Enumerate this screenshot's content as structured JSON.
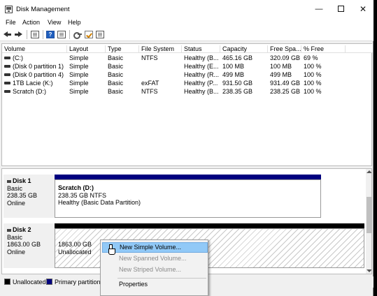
{
  "window": {
    "title": "Disk Management",
    "minimize_glyph": "—",
    "close_glyph": "✕"
  },
  "menu": [
    "File",
    "Action",
    "View",
    "Help"
  ],
  "toolbar": {
    "icons": [
      "back-arrow-icon",
      "forward-arrow-icon",
      "console-tree-icon",
      "help-icon",
      "properties-icon",
      "rescan-key-icon",
      "check-disks-icon",
      "settings-list-icon"
    ]
  },
  "volume_list": {
    "columns": [
      "Volume",
      "Layout",
      "Type",
      "File System",
      "Status",
      "Capacity",
      "Free Spa...",
      "% Free"
    ],
    "rows": [
      [
        "(C:)",
        "Simple",
        "Basic",
        "NTFS",
        "Healthy (B...",
        "465.16 GB",
        "320.09 GB",
        "69 %"
      ],
      [
        "(Disk 0 partition 1)",
        "Simple",
        "Basic",
        "",
        "Healthy (E...",
        "100 MB",
        "100 MB",
        "100 %"
      ],
      [
        "(Disk 0 partition 4)",
        "Simple",
        "Basic",
        "",
        "Healthy (R...",
        "499 MB",
        "499 MB",
        "100 %"
      ],
      [
        "1TB Lacie (K:)",
        "Simple",
        "Basic",
        "exFAT",
        "Healthy (P...",
        "931.50 GB",
        "931.49 GB",
        "100 %"
      ],
      [
        "Scratch (D:)",
        "Simple",
        "Basic",
        "NTFS",
        "Healthy (B...",
        "238.35 GB",
        "238.25 GB",
        "100 %"
      ]
    ]
  },
  "disks": [
    {
      "name": "Disk 1",
      "type": "Basic",
      "size": "238.35 GB",
      "state": "Online",
      "partition": {
        "name": "Scratch  (D:)",
        "detail": "238.35 GB NTFS",
        "status": "Healthy (Basic Data Partition)",
        "header_color": "#00007f"
      }
    },
    {
      "name": "Disk 2",
      "type": "Basic",
      "size": "1863.00 GB",
      "state": "Online",
      "partition": {
        "size": "1863.00 GB",
        "status": "Unallocated",
        "header_color": "#000000"
      }
    }
  ],
  "legend": [
    {
      "label": "Unallocated",
      "color": "#000000"
    },
    {
      "label": "Primary partition",
      "color": "#00007f"
    }
  ],
  "context_menu": {
    "items": [
      {
        "label": "New Simple Volume...",
        "enabled": true,
        "highlighted": true
      },
      {
        "label": "New Spanned Volume...",
        "enabled": false,
        "highlighted": false
      },
      {
        "label": "New Striped Volume...",
        "enabled": false,
        "highlighted": false
      },
      {
        "label": "Properties",
        "enabled": true,
        "highlighted": false
      }
    ]
  }
}
